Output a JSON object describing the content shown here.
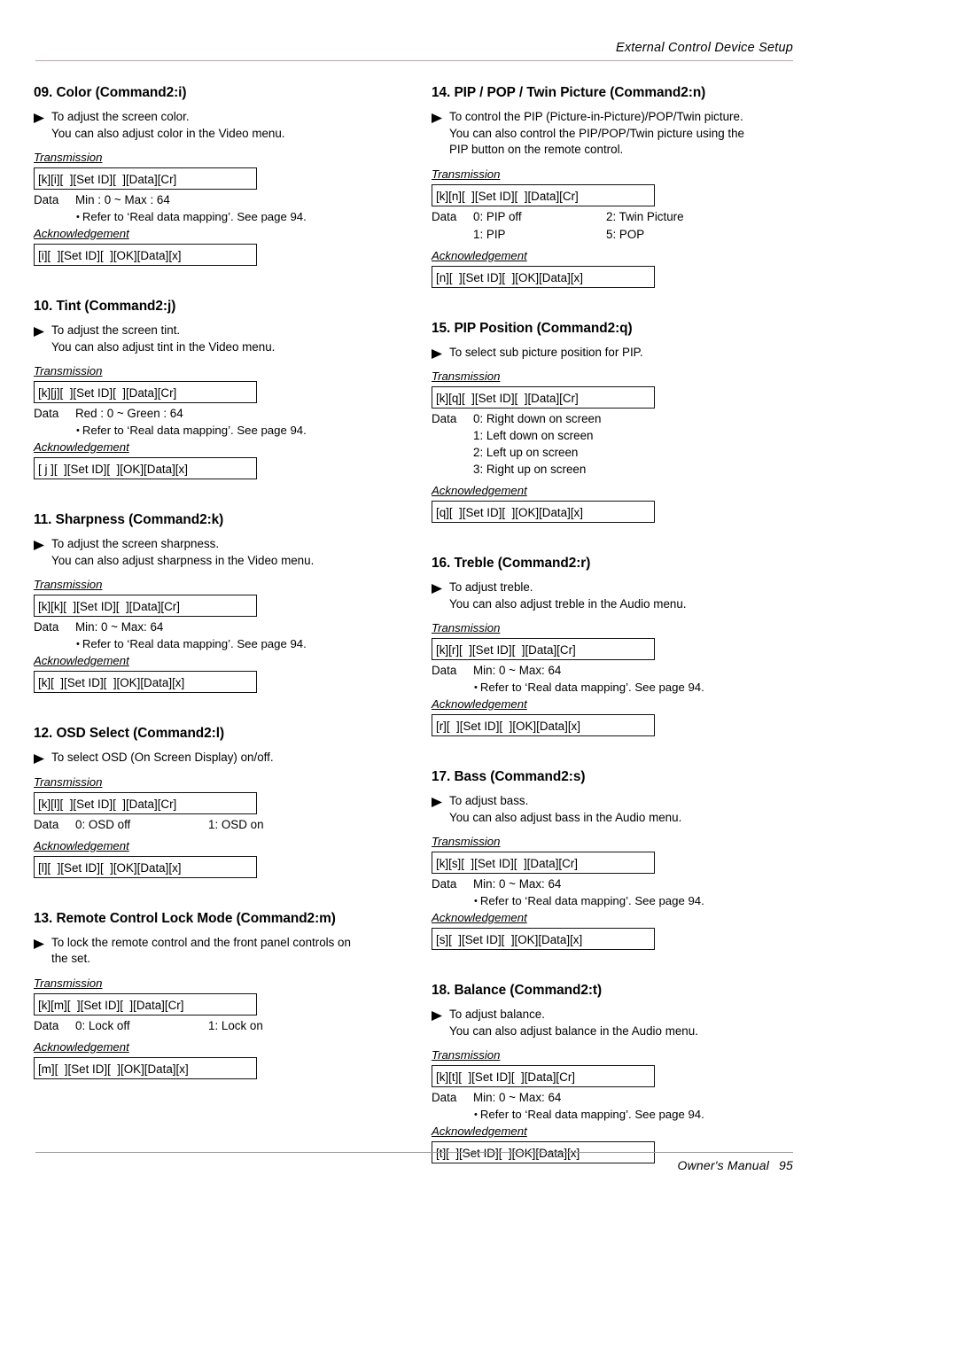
{
  "header": {
    "title": "External Control Device Setup"
  },
  "footer": {
    "manual_label": "Owner's Manual",
    "page_number": "95"
  },
  "labels": {
    "transmission": "Transmission",
    "acknowledgement": "Acknowledgement",
    "data": "Data",
    "note": "Refer to ‘Real data mapping’. See page 94.",
    "bullet": "•"
  },
  "left_column": [
    {
      "title": "09. Color (Command2:i)",
      "desc": [
        "To adjust the screen color.",
        "You can also adjust color in the Video menu."
      ],
      "transmission": "[k][i][  ][Set ID][  ][Data][Cr]",
      "data_label": "Data",
      "data_value": "Min : 0 ~ Max : 64",
      "note": "Refer to ‘Real data mapping’. See page 94.",
      "acknowledgement": "[i][  ][Set ID][  ][OK][Data][x]"
    },
    {
      "title": "10. Tint (Command2:j)",
      "desc": [
        "To adjust the screen tint.",
        "You can also adjust tint in the Video menu."
      ],
      "transmission": "[k][j][  ][Set ID][  ][Data][Cr]",
      "data_label": "Data",
      "data_value": "Red : 0 ~ Green : 64",
      "note": "Refer to ‘Real data mapping’. See page 94.",
      "acknowledgement": "[ j ][  ][Set ID][  ][OK][Data][x]"
    },
    {
      "title": "11. Sharpness (Command2:k)",
      "desc": [
        "To adjust the screen sharpness.",
        "You can also adjust sharpness in the Video menu."
      ],
      "transmission": "[k][k][  ][Set ID][  ][Data][Cr]",
      "data_label": "Data",
      "data_value": "Min: 0 ~ Max: 64",
      "note": "Refer to ‘Real data mapping’. See page 94.",
      "acknowledgement": "[k][  ][Set ID][  ][OK][Data][x]"
    },
    {
      "title": "12. OSD Select (Command2:l)",
      "desc": [
        "To select OSD (On Screen Display) on/off."
      ],
      "transmission": "[k][l][  ][Set ID][  ][Data][Cr]",
      "data_label": "Data",
      "data_options": [
        {
          "c1": "0: OSD off",
          "c2": "1: OSD on"
        }
      ],
      "acknowledgement": "[l][  ][Set ID][  ][OK][Data][x]"
    },
    {
      "title": "13. Remote Control Lock Mode (Command2:m)",
      "desc": [
        "To lock the remote control and the front panel controls on",
        "the set."
      ],
      "transmission": "[k][m][  ][Set ID][  ][Data][Cr]",
      "data_label": "Data",
      "data_options": [
        {
          "c1": "0: Lock off",
          "c2": "1: Lock on"
        }
      ],
      "acknowledgement": "[m][  ][Set ID][  ][OK][Data][x]"
    }
  ],
  "right_column": [
    {
      "title": "14. PIP / POP / Twin Picture (Command2:n)",
      "desc": [
        "To control the PIP (Picture-in-Picture)/POP/Twin picture.",
        "You can also control the PIP/POP/Twin picture using the",
        "PIP button on the remote control."
      ],
      "transmission": "[k][n][  ][Set ID][  ][Data][Cr]",
      "data_label": "Data",
      "data_options": [
        {
          "c1": "0: PIP off",
          "c2": "2: Twin Picture"
        },
        {
          "c1": "1: PIP",
          "c2": "5: POP"
        }
      ],
      "acknowledgement": "[n][  ][Set ID][  ][OK][Data][x]"
    },
    {
      "title": "15. PIP Position (Command2:q)",
      "desc": [
        "To select sub picture position for PIP."
      ],
      "transmission": "[k][q][  ][Set ID][  ][Data][Cr]",
      "data_label": "Data",
      "data_list": [
        "0: Right down on screen",
        "1: Left down on screen",
        "2: Left up on screen",
        "3: Right up on screen"
      ],
      "acknowledgement": "[q][  ][Set ID][  ][OK][Data][x]"
    },
    {
      "title": "16. Treble (Command2:r)",
      "desc": [
        "To adjust treble.",
        "You can also adjust treble in the Audio menu."
      ],
      "transmission": "[k][r][  ][Set ID][  ][Data][Cr]",
      "data_label": "Data",
      "data_value": "Min: 0 ~ Max: 64",
      "note": "Refer to ‘Real data mapping’. See page 94.",
      "acknowledgement": "[r][  ][Set ID][  ][OK][Data][x]"
    },
    {
      "title": "17. Bass (Command2:s)",
      "desc": [
        "To adjust bass.",
        "You can also adjust bass in the Audio menu."
      ],
      "transmission": "[k][s][  ][Set ID][  ][Data][Cr]",
      "data_label": "Data",
      "data_value": "Min: 0 ~ Max: 64",
      "note": "Refer to ‘Real data mapping’. See page 94.",
      "acknowledgement": "[s][  ][Set ID][  ][OK][Data][x]"
    },
    {
      "title": "18. Balance (Command2:t)",
      "desc": [
        "To adjust balance.",
        "You can also adjust balance in the Audio menu."
      ],
      "transmission": "[k][t][  ][Set ID][  ][Data][Cr]",
      "data_label": "Data",
      "data_value": "Min: 0 ~ Max: 64",
      "note": "Refer to ‘Real data mapping’. See page 94.",
      "acknowledgement": "[t][  ][Set ID][  ][OK][Data][x]"
    }
  ]
}
